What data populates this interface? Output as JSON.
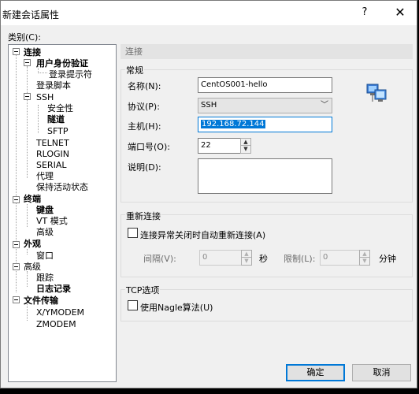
{
  "window": {
    "title": "新建会话属性",
    "help_label": "?",
    "close_label": "✕"
  },
  "category_label": "类别(C):",
  "tree": {
    "items": [
      {
        "label": "连接",
        "bold": true
      },
      {
        "label": "用户身份验证",
        "bold": true
      },
      {
        "label": "登录提示符",
        "bold": false
      },
      {
        "label": "登录脚本",
        "bold": false
      },
      {
        "label": "SSH",
        "bold": false
      },
      {
        "label": "安全性",
        "bold": false
      },
      {
        "label": "隧道",
        "bold": true
      },
      {
        "label": "SFTP",
        "bold": false
      },
      {
        "label": "TELNET",
        "bold": false
      },
      {
        "label": "RLOGIN",
        "bold": false
      },
      {
        "label": "SERIAL",
        "bold": false
      },
      {
        "label": "代理",
        "bold": false
      },
      {
        "label": "保持活动状态",
        "bold": false
      },
      {
        "label": "终端",
        "bold": true
      },
      {
        "label": "键盘",
        "bold": true
      },
      {
        "label": "VT 模式",
        "bold": false
      },
      {
        "label": "高级",
        "bold": false
      },
      {
        "label": "外观",
        "bold": true
      },
      {
        "label": "窗口",
        "bold": false
      },
      {
        "label": "高级",
        "bold": false
      },
      {
        "label": "跟踪",
        "bold": false
      },
      {
        "label": "日志记录",
        "bold": true
      },
      {
        "label": "文件传输",
        "bold": true
      },
      {
        "label": "X/YMODEM",
        "bold": false
      },
      {
        "label": "ZMODEM",
        "bold": false
      }
    ]
  },
  "panel": {
    "header": "连接",
    "general": {
      "title": "常规",
      "name_label": "名称(N):",
      "name_value": "CentOS001-hello",
      "protocol_label": "协议(P):",
      "protocol_value": "SSH",
      "host_label": "主机(H):",
      "host_value": "192.168.72.144",
      "port_label": "端口号(O):",
      "port_value": "22",
      "description_label": "说明(D):",
      "description_value": ""
    },
    "reconnect": {
      "title": "重新连接",
      "auto_reconnect_label": "连接异常关闭时自动重新连接(A)",
      "auto_reconnect_checked": false,
      "interval_label": "间隔(V):",
      "interval_value": "0",
      "interval_unit": "秒",
      "limit_label": "限制(L):",
      "limit_value": "0",
      "limit_unit": "分钟"
    },
    "tcp": {
      "title": "TCP选项",
      "nagle_label": "使用Nagle算法(U)",
      "nagle_checked": false
    }
  },
  "buttons": {
    "ok": "确定",
    "cancel": "取消"
  },
  "colors": {
    "selection": "#0078d7",
    "dialog_bg": "#f0f0f0",
    "header_bg": "#e3e3e3"
  }
}
